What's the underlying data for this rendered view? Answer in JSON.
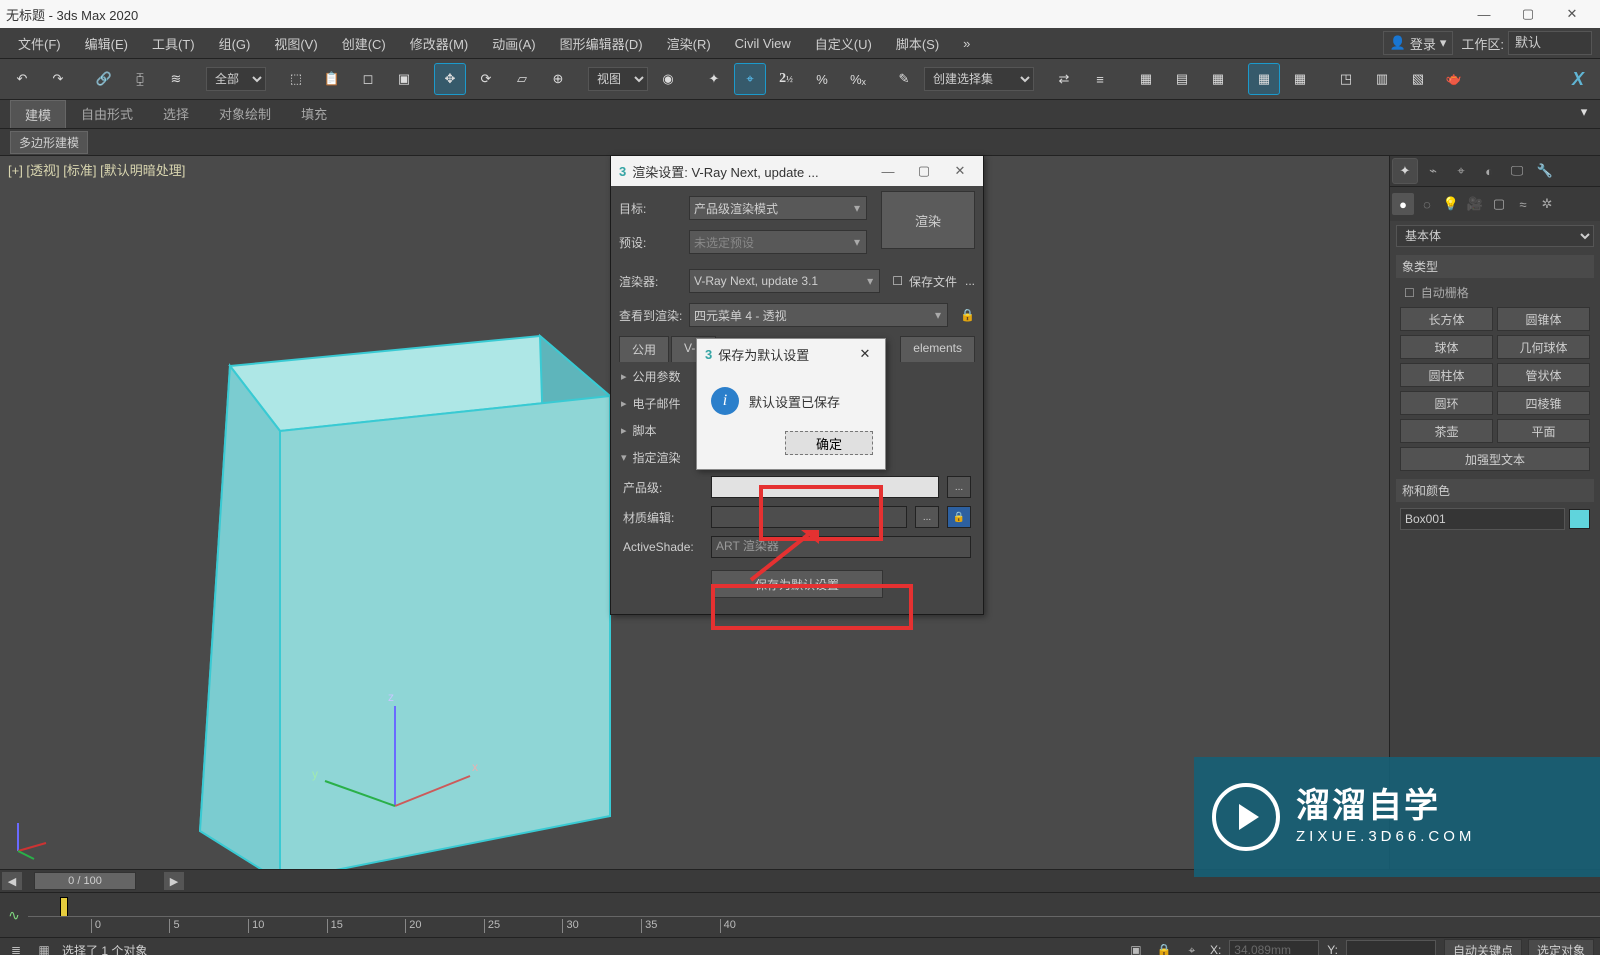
{
  "titlebar": {
    "title": "无标题 - 3ds Max 2020"
  },
  "menu": {
    "items": [
      "文件(F)",
      "编辑(E)",
      "工具(T)",
      "组(G)",
      "视图(V)",
      "创建(C)",
      "修改器(M)",
      "动画(A)",
      "图形编辑器(D)",
      "渲染(R)",
      "Civil View",
      "自定义(U)",
      "脚本(S)"
    ],
    "login": "登录",
    "workspace_label": "工作区:",
    "workspace_value": "默认"
  },
  "toolbar": {
    "sel_filter": "全部",
    "ref_sys": "视图",
    "named_sel": "创建选择集"
  },
  "ribbon": {
    "tabs": [
      "建模",
      "自由形式",
      "选择",
      "对象绘制",
      "填充"
    ],
    "subtab": "多边形建模"
  },
  "viewport": {
    "label": "[+] [透视] [标准] [默认明暗处理]"
  },
  "render_settings": {
    "title": "渲染设置: V-Ray Next, update ...",
    "target_label": "目标:",
    "target_value": "产品级渲染模式",
    "preset_label": "预设:",
    "preset_value": "未选定预设",
    "renderer_label": "渲染器:",
    "renderer_value": "V-Ray Next, update 3.1",
    "save_file_label": "保存文件",
    "view_label": "查看到渲染:",
    "view_value": "四元菜单 4 - 透视",
    "render_btn": "渲染",
    "tabs": [
      "公用",
      "V-P",
      "",
      "elements"
    ],
    "rollouts": [
      "公用参数",
      "电子邮件",
      "脚本",
      "指定渲染"
    ],
    "prod_label": "产品级:",
    "mat_label": "材质编辑:",
    "as_label": "ActiveShade:",
    "as_value": "ART 渲染器",
    "save_default": "保存为默认设置"
  },
  "info_dialog": {
    "title": "保存为默认设置",
    "message": "默认设置已保存",
    "ok": "确定"
  },
  "side": {
    "cat": "基本体",
    "obj_type": "象类型",
    "auto_grid": "自动栅格",
    "primitives": [
      "长方体",
      "圆锥体",
      "球体",
      "几何球体",
      "圆柱体",
      "管状体",
      "圆环",
      "四棱锥",
      "茶壶",
      "平面",
      "加强型文本"
    ],
    "name_section": "称和颜色",
    "obj_name": "Box001"
  },
  "timeslider": {
    "value": "0 / 100"
  },
  "ruler_ticks": [
    "0",
    "5",
    "10",
    "15",
    "20",
    "25",
    "30",
    "35",
    "40"
  ],
  "status": {
    "selection": "选择了 1 个对象",
    "x_label": "X:",
    "x_val": "34.089mm",
    "y_label": "Y:",
    "auto_key": "自动关键点",
    "sel_obj": "选定对象"
  },
  "watermark": {
    "brand": "溜溜自学",
    "sub": "ZIXUE.3D66.COM"
  }
}
